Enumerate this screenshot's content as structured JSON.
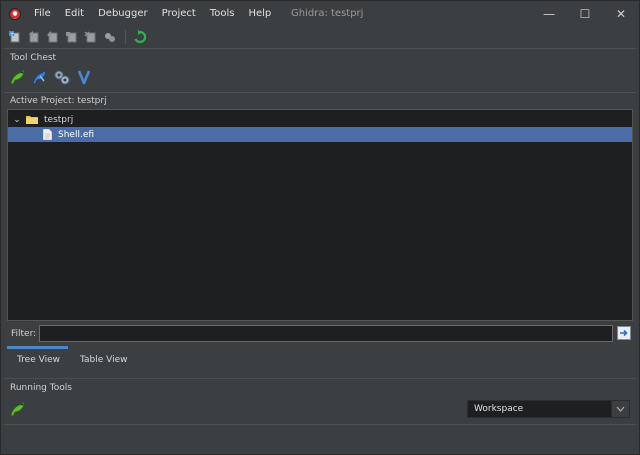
{
  "window": {
    "title": "Ghidra: testprj",
    "controls": {
      "minimize": "—",
      "maximize": "☐",
      "close": "✕"
    }
  },
  "menu": [
    "File",
    "Edit",
    "Debugger",
    "Project",
    "Tools",
    "Help"
  ],
  "toolbar": {
    "icons": [
      "new-project-icon",
      "open-project-icon",
      "close-project-icon",
      "save-project-icon",
      "delete-project-icon",
      "archive-icon",
      "refresh-icon"
    ]
  },
  "tool_chest": {
    "label": "Tool Chest",
    "tools": [
      "dragon-codebrowser-icon",
      "dragon-debugger-icon",
      "version-tracking-icon",
      "emulator-icon"
    ]
  },
  "active_project": {
    "label": "Active Project: testprj",
    "tree": [
      {
        "name": "testprj",
        "type": "folder",
        "expanded": true,
        "selected": false
      },
      {
        "name": "Shell.efi",
        "type": "file",
        "selected": true
      }
    ]
  },
  "filter": {
    "label": "Filter:",
    "value": ""
  },
  "view_tabs": [
    "Tree View",
    "Table View"
  ],
  "running_tools": {
    "label": "Running Tools",
    "tools": [
      "dragon-codebrowser-icon"
    ],
    "workspace": "Workspace"
  },
  "colors": {
    "background": "#3c3f41",
    "panel": "#1e1f21",
    "selection": "#4a6da7",
    "accent": "#4a88c7"
  }
}
